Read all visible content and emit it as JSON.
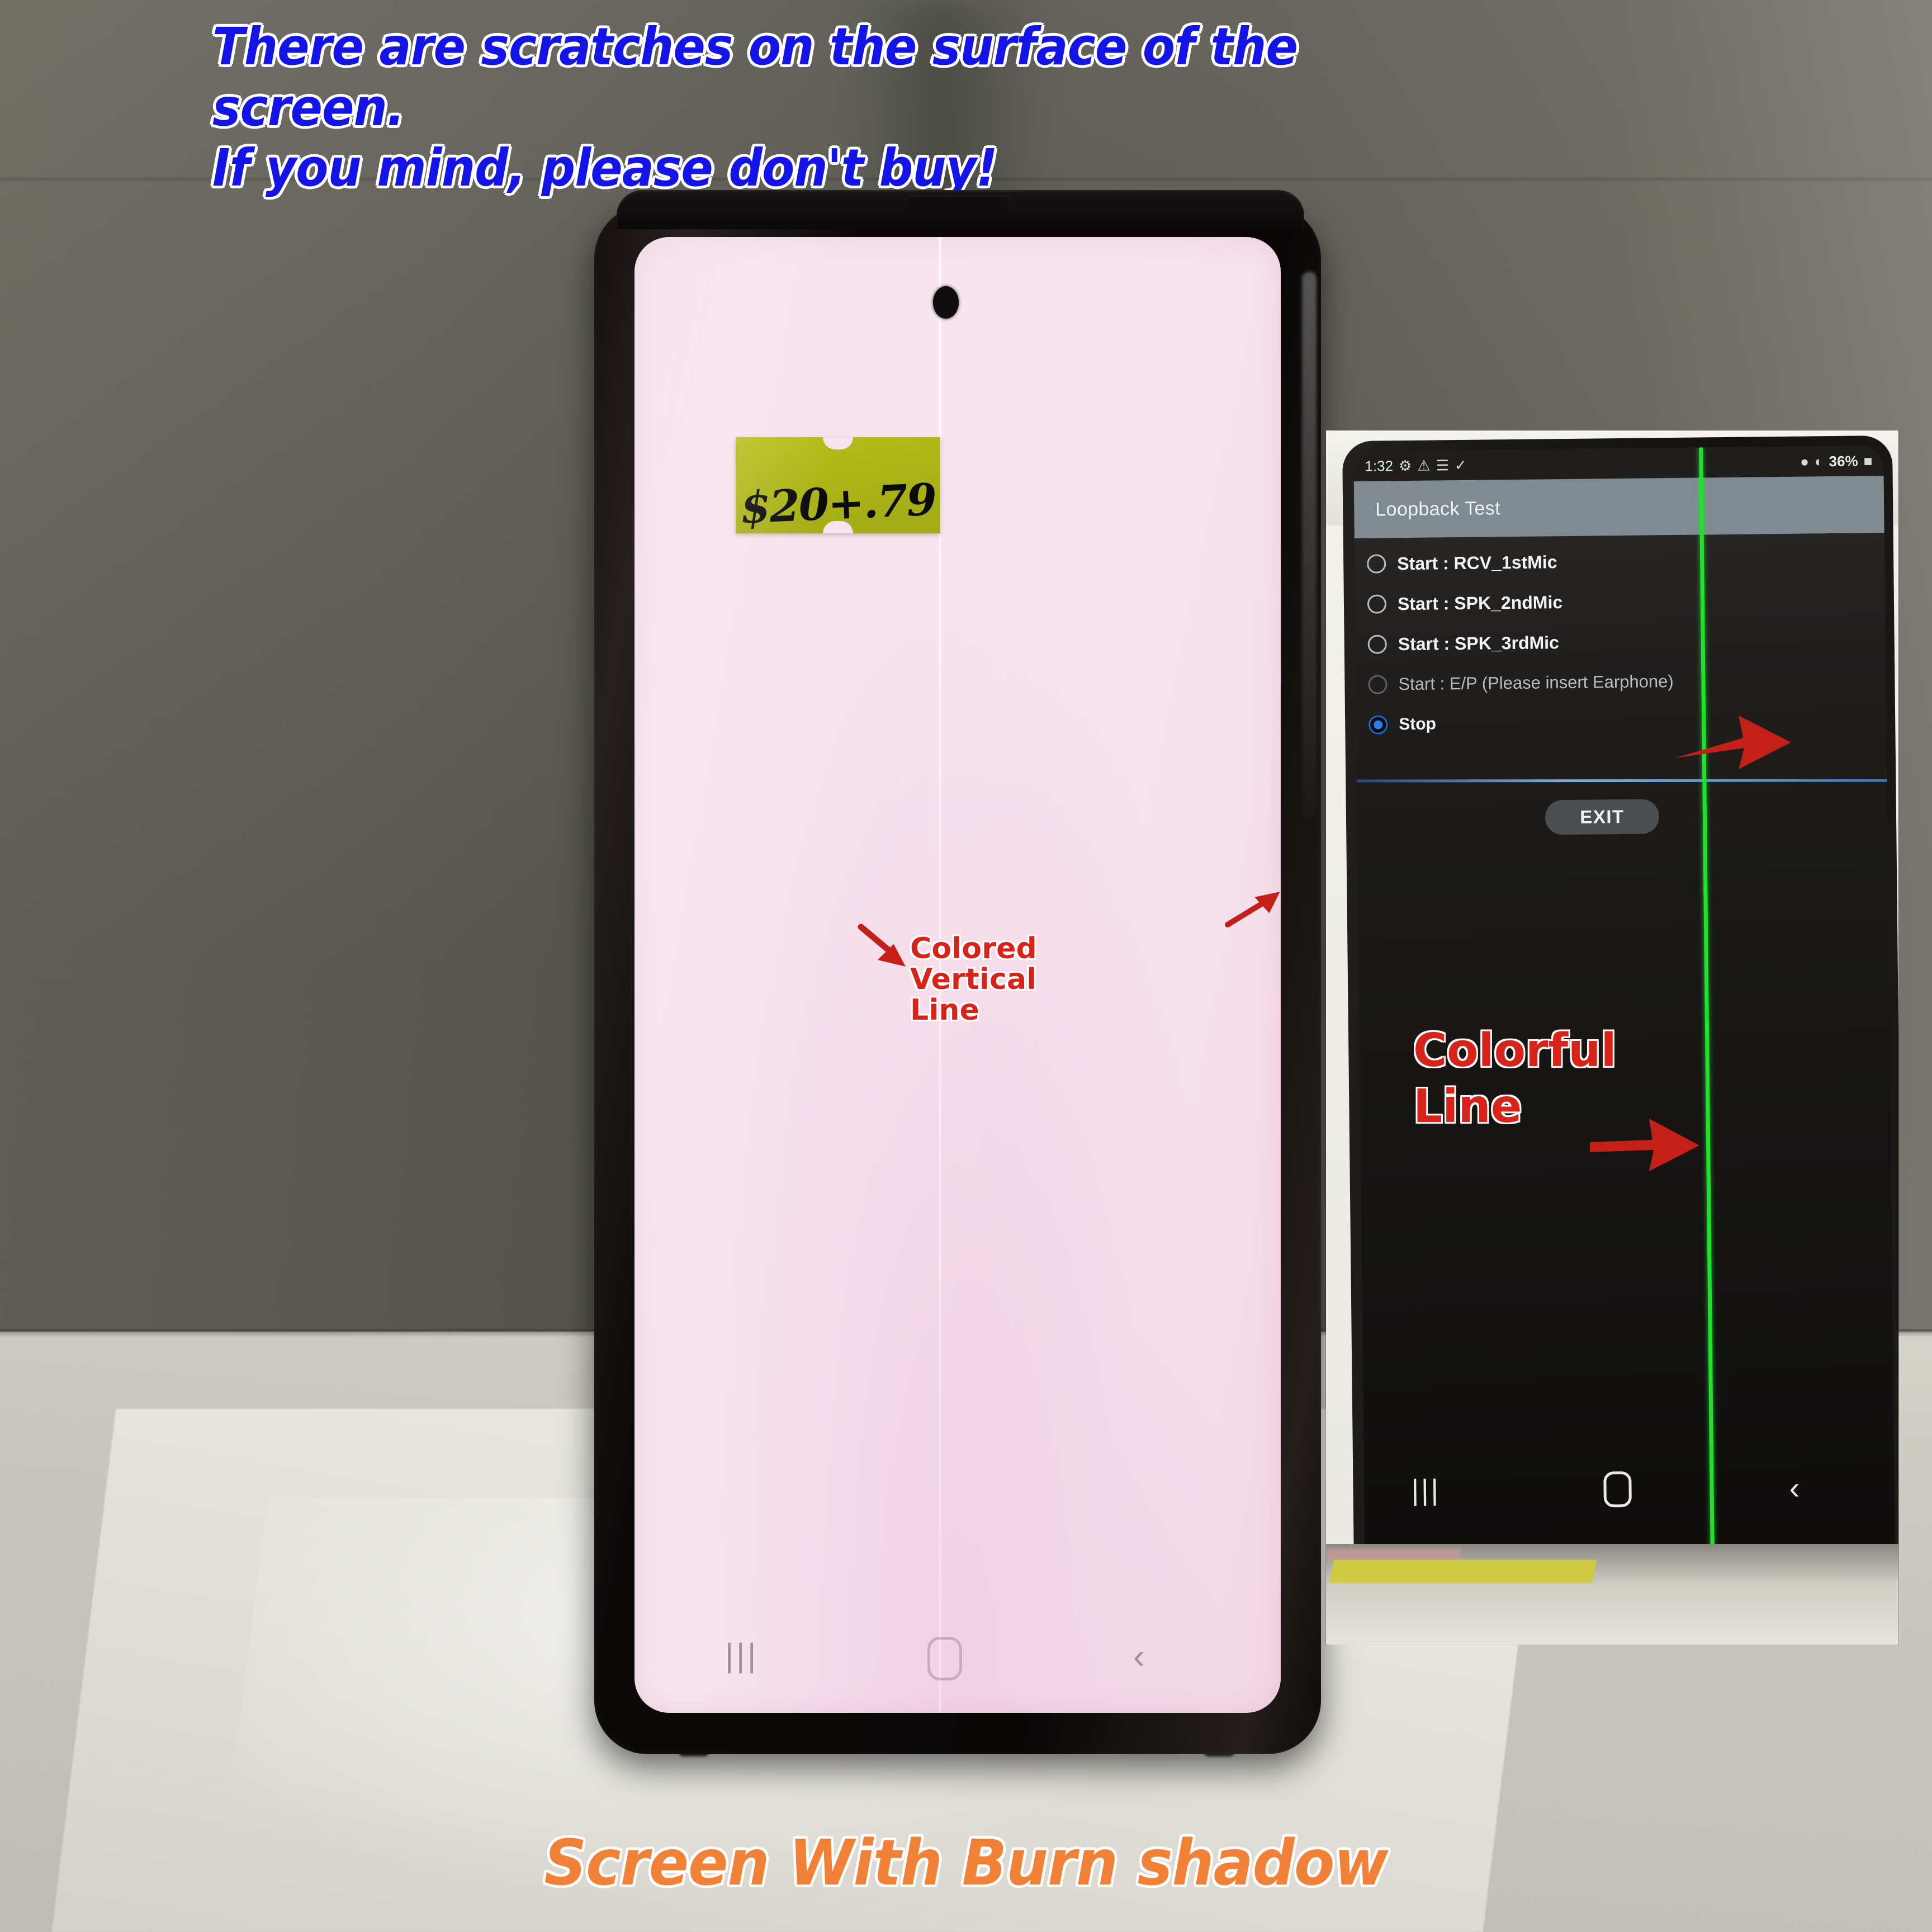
{
  "headline": {
    "line1": "There are scratches on the surface of the screen.",
    "line2": "If you mind, please don't buy!",
    "color": "#1414e6"
  },
  "caption": {
    "text": "Screen With Burn shadow",
    "color": "#f08137"
  },
  "main_phone": {
    "screen_color": "#f7e2ee",
    "price_label": {
      "text": "$20+.79",
      "color": "#acb417"
    },
    "annotation": {
      "line1": "Colored",
      "line2": "Vertical",
      "line3": "Line",
      "color": "#d8231b"
    },
    "nav_bar": {
      "recents_icon": "recents-icon",
      "home_icon": "home-icon",
      "back_icon": "back-icon"
    },
    "defect": "burn-shadow-vertical-line"
  },
  "inset": {
    "status_bar": {
      "time": "1:32",
      "icons": [
        "gear-icon",
        "warning-icon",
        "wifi-icon",
        "check-circle-icon"
      ],
      "right_icons": [
        "location-icon",
        "signal-icon"
      ],
      "battery": "36%",
      "battery_icon": "battery-icon"
    },
    "app_bar": {
      "title": "Loopback Test"
    },
    "options": [
      {
        "label": "Start : RCV_1stMic",
        "selected": false,
        "dim": false
      },
      {
        "label": "Start : SPK_2ndMic",
        "selected": false,
        "dim": false
      },
      {
        "label": "Start : SPK_3rdMic",
        "selected": false,
        "dim": false
      },
      {
        "label": "Start : E/P (Please insert Earphone)",
        "selected": false,
        "dim": true
      },
      {
        "label": "Stop",
        "selected": true,
        "dim": false
      }
    ],
    "exit_button": {
      "label": "EXIT"
    },
    "annotation": {
      "line1": "Colorful",
      "line2": "Line",
      "color": "#ee2222"
    },
    "green_line_color": "#1ee32a",
    "blue_line_color": "#7fb5e8",
    "nav_bar": {
      "recents_icon": "recents-icon",
      "home_icon": "home-icon",
      "back_icon": "back-icon"
    }
  }
}
